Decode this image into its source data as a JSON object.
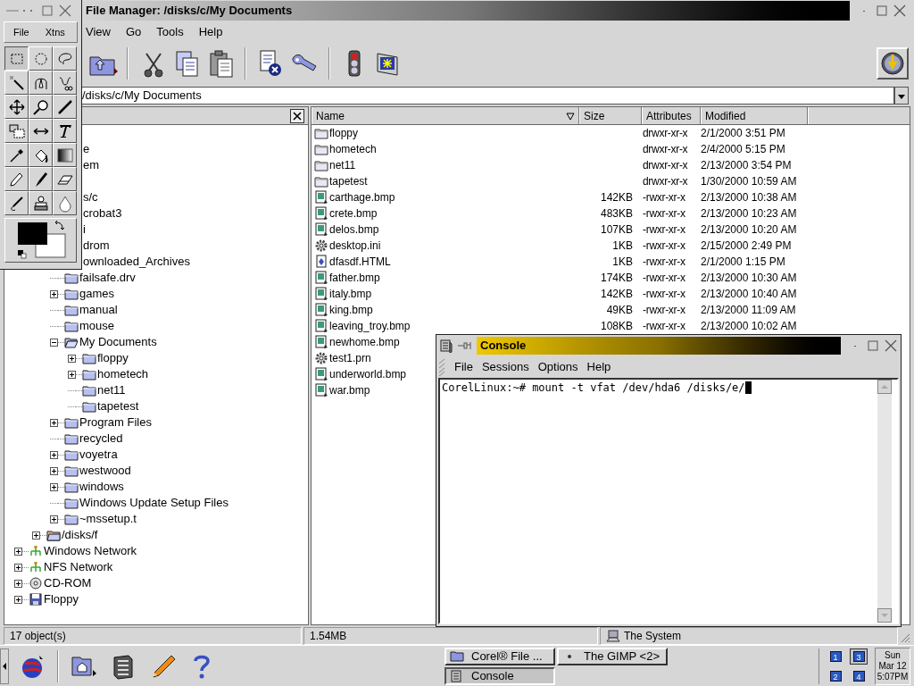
{
  "file_manager": {
    "title": "File Manager: /disks/c/My Documents",
    "menu": [
      "View",
      "Go",
      "Tools",
      "Help"
    ],
    "address": "/disks/c/My Documents",
    "tree": [
      {
        "children": [
          {
            "label": "e"
          },
          {
            "label": "em"
          },
          {
            "label": "s/c",
            "children": [
              {
                "label": "crobat3"
              },
              {
                "label": "i"
              },
              {
                "label": "drom"
              },
              {
                "label": "ownloaded_Archives"
              },
              {
                "label": "failsafe.drv",
                "kind": "folder"
              },
              {
                "label": "games",
                "kind": "folder",
                "expandable": true
              },
              {
                "label": "manual",
                "kind": "folder"
              },
              {
                "label": "mouse",
                "kind": "folder"
              },
              {
                "label": "My Documents",
                "kind": "folder-open",
                "expandable": true,
                "expanded": true,
                "children": [
                  {
                    "label": "floppy",
                    "kind": "folder",
                    "expandable": true
                  },
                  {
                    "label": "hometech",
                    "kind": "folder",
                    "expandable": true
                  },
                  {
                    "label": "net11",
                    "kind": "folder"
                  },
                  {
                    "label": "tapetest",
                    "kind": "folder"
                  }
                ]
              },
              {
                "label": "Program Files",
                "kind": "folder",
                "expandable": true
              },
              {
                "label": "recycled",
                "kind": "folder"
              },
              {
                "label": "voyetra",
                "kind": "folder",
                "expandable": true
              },
              {
                "label": "westwood",
                "kind": "folder",
                "expandable": true
              },
              {
                "label": "windows",
                "kind": "folder",
                "expandable": true
              },
              {
                "label": "Windows Update Setup Files",
                "kind": "folder"
              },
              {
                "label": "~mssetup.t",
                "kind": "folder",
                "expandable": true
              }
            ]
          },
          {
            "label": "/disks/f",
            "kind": "drive",
            "expandable": true
          }
        ]
      },
      {
        "label": "Windows Network",
        "kind": "network",
        "expandable": true
      },
      {
        "label": "NFS Network",
        "kind": "network",
        "expandable": true
      },
      {
        "label": "CD-ROM",
        "kind": "cdrom",
        "expandable": true
      },
      {
        "label": "Floppy",
        "kind": "floppy",
        "expandable": true
      }
    ],
    "columns": [
      "Name",
      "Size",
      "Attributes",
      "Modified"
    ],
    "files": [
      {
        "name": "floppy",
        "kind": "folder",
        "attributes": "drwxr-xr-x",
        "modified": "2/1/2000 3:51 PM"
      },
      {
        "name": "hometech",
        "kind": "folder",
        "attributes": "drwxr-xr-x",
        "modified": "2/4/2000 5:15 PM"
      },
      {
        "name": "net11",
        "kind": "folder",
        "attributes": "drwxr-xr-x",
        "modified": "2/13/2000 3:54 PM"
      },
      {
        "name": "tapetest",
        "kind": "folder",
        "attributes": "drwxr-xr-x",
        "modified": "1/30/2000 10:59 AM"
      },
      {
        "name": "carthage.bmp",
        "kind": "image",
        "size": "142KB",
        "attributes": "-rwxr-xr-x",
        "modified": "2/13/2000 10:38 AM"
      },
      {
        "name": "crete.bmp",
        "kind": "image",
        "size": "483KB",
        "attributes": "-rwxr-xr-x",
        "modified": "2/13/2000 10:23 AM"
      },
      {
        "name": "delos.bmp",
        "kind": "image",
        "size": "107KB",
        "attributes": "-rwxr-xr-x",
        "modified": "2/13/2000 10:20 AM"
      },
      {
        "name": "desktop.ini",
        "kind": "settings",
        "size": "1KB",
        "attributes": "-rwxr-xr-x",
        "modified": "2/15/2000 2:49 PM"
      },
      {
        "name": "dfasdf.HTML",
        "kind": "html",
        "size": "1KB",
        "attributes": "-rwxr-xr-x",
        "modified": "2/1/2000 1:15 PM"
      },
      {
        "name": "father.bmp",
        "kind": "image",
        "size": "174KB",
        "attributes": "-rwxr-xr-x",
        "modified": "2/13/2000 10:30 AM"
      },
      {
        "name": "italy.bmp",
        "kind": "image",
        "size": "142KB",
        "attributes": "-rwxr-xr-x",
        "modified": "2/13/2000 10:40 AM"
      },
      {
        "name": "king.bmp",
        "kind": "image",
        "size": "49KB",
        "attributes": "-rwxr-xr-x",
        "modified": "2/13/2000 11:09 AM"
      },
      {
        "name": "leaving_troy.bmp",
        "kind": "image",
        "size": "108KB",
        "attributes": "-rwxr-xr-x",
        "modified": "2/13/2000 10:02 AM"
      },
      {
        "name": "newhome.bmp",
        "kind": "image"
      },
      {
        "name": "test1.prn",
        "kind": "settings"
      },
      {
        "name": "underworld.bmp",
        "kind": "image"
      },
      {
        "name": "war.bmp",
        "kind": "image"
      }
    ],
    "status": [
      "17 object(s)",
      "1.54MB",
      "The System"
    ]
  },
  "gimp_toolbox": {
    "menu": [
      "File",
      "Xtns"
    ],
    "tools": [
      {
        "kind": "rect-select",
        "selected": true
      },
      {
        "kind": "ellipse-select",
        "selected": false
      },
      {
        "kind": "lasso",
        "selected": false
      },
      {
        "kind": "wand",
        "selected": false
      },
      {
        "kind": "pen",
        "selected": false
      },
      {
        "kind": "scissors",
        "selected": false
      },
      {
        "kind": "move",
        "selected": false
      },
      {
        "kind": "magnify",
        "selected": false
      },
      {
        "kind": "knife",
        "selected": false
      },
      {
        "kind": "crop",
        "selected": false
      },
      {
        "kind": "flip",
        "selected": false
      },
      {
        "kind": "text",
        "selected": false
      },
      {
        "kind": "eyedropper",
        "selected": false
      },
      {
        "kind": "bucket",
        "selected": false
      },
      {
        "kind": "gradient",
        "selected": false
      },
      {
        "kind": "pencil",
        "selected": false
      },
      {
        "kind": "brush",
        "selected": false
      },
      {
        "kind": "eraser",
        "selected": false
      },
      {
        "kind": "airbrush",
        "selected": false
      },
      {
        "kind": "stamp",
        "selected": false
      },
      {
        "kind": "drop",
        "selected": false
      }
    ]
  },
  "console": {
    "title": "Console",
    "menu": [
      "File",
      "Sessions",
      "Options",
      "Help"
    ],
    "lines": [
      "CorelLinux:~# mount -t vfat /dev/hda6 /disks/e/"
    ]
  },
  "taskbar": {
    "tasks": [
      {
        "label": "Corel® File ...",
        "kind": "file-manager",
        "selected": false
      },
      {
        "label": "The GIMP <2>",
        "kind": "gimp",
        "selected": false
      },
      {
        "label": "Console",
        "kind": "console",
        "selected": true
      }
    ],
    "pager": [
      {
        "label": "1",
        "selected": false
      },
      {
        "label": "3",
        "selected": true
      },
      {
        "label": "2",
        "selected": false
      },
      {
        "label": "4",
        "selected": false
      }
    ],
    "clock": [
      "Sun",
      "Mar 12",
      "5:07PM"
    ]
  }
}
